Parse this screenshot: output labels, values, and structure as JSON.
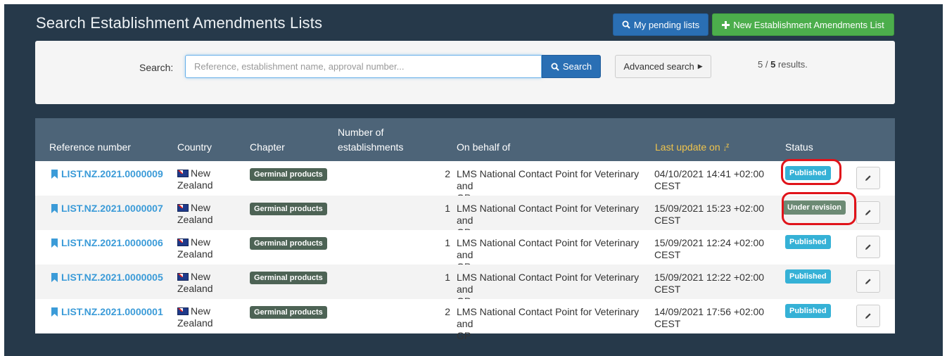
{
  "page": {
    "title": "Search Establishment Amendments Lists",
    "pending_button": "My pending lists",
    "new_button": "New Establishment Amendments List"
  },
  "search": {
    "label": "Search:",
    "placeholder": "Reference, establishment name, approval number...",
    "value": "",
    "search_button": "Search",
    "advanced_button": "Advanced search",
    "results_count": "5 / ",
    "results_total": "5",
    "results_suffix": " results."
  },
  "table": {
    "headers": {
      "reference": "Reference number",
      "country": "Country",
      "chapter": "Chapter",
      "num_establishments_1": "Number of",
      "num_establishments_2": "establishments",
      "on_behalf": "On behalf of",
      "last_update": "Last update on",
      "status": "Status"
    },
    "rows": [
      {
        "ref": "LIST.NZ.2021.0000009",
        "country1": "New",
        "country2": "Zealand",
        "chapter": "Germinal products",
        "num": "2",
        "behalf1": "LMS National Contact Point for Veterinary and",
        "behalf2": "GP",
        "upd1": "04/10/2021 14:41 +02:00",
        "upd2": "CEST",
        "status": "Published"
      },
      {
        "ref": "LIST.NZ.2021.0000007",
        "country1": "New",
        "country2": "Zealand",
        "chapter": "Germinal products",
        "num": "1",
        "behalf1": "LMS National Contact Point for Veterinary and",
        "behalf2": "GP",
        "upd1": "15/09/2021 15:23 +02:00",
        "upd2": "CEST",
        "status": "Under revision"
      },
      {
        "ref": "LIST.NZ.2021.0000006",
        "country1": "New",
        "country2": "Zealand",
        "chapter": "Germinal products",
        "num": "1",
        "behalf1": "LMS National Contact Point for Veterinary and",
        "behalf2": "GP",
        "upd1": "15/09/2021 12:24 +02:00",
        "upd2": "CEST",
        "status": "Published"
      },
      {
        "ref": "LIST.NZ.2021.0000005",
        "country1": "New",
        "country2": "Zealand",
        "chapter": "Germinal products",
        "num": "1",
        "behalf1": "LMS National Contact Point for Veterinary and",
        "behalf2": "GP",
        "upd1": "15/09/2021 12:22 +02:00",
        "upd2": "CEST",
        "status": "Published"
      },
      {
        "ref": "LIST.NZ.2021.0000001",
        "country1": "New",
        "country2": "Zealand",
        "chapter": "Germinal products",
        "num": "2",
        "behalf1": "LMS National Contact Point for Veterinary and",
        "behalf2": "GP",
        "upd1": "14/09/2021 17:56 +02:00",
        "upd2": "CEST",
        "status": "Published"
      }
    ]
  },
  "colors": {
    "frame": "#26394a",
    "header": "#4d6478",
    "link": "#3b9bd8",
    "sort_active": "#f0c44c",
    "annotation": "#e0131a"
  }
}
